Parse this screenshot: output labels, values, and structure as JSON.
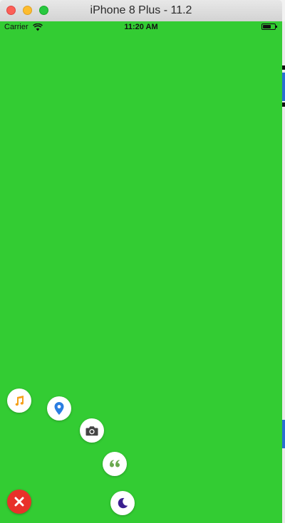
{
  "window": {
    "title": "iPhone 8 Plus - 11.2"
  },
  "status_bar": {
    "carrier": "Carrier",
    "time": "11:20 AM",
    "icons": [
      "wifi-icon",
      "battery-icon"
    ]
  },
  "screen": {
    "background_color": "#33cc33"
  },
  "floating_menu": {
    "close_button": {
      "icon": "close-icon",
      "color": "#e8312a"
    },
    "items": [
      {
        "icon": "music-note-icon",
        "color": "#f5a01a"
      },
      {
        "icon": "location-pin-icon",
        "color": "#2a7de1"
      },
      {
        "icon": "camera-icon",
        "color": "#444444"
      },
      {
        "icon": "quote-icon",
        "color": "#6aa84f"
      },
      {
        "icon": "moon-icon",
        "color": "#3a1f8f"
      }
    ]
  }
}
